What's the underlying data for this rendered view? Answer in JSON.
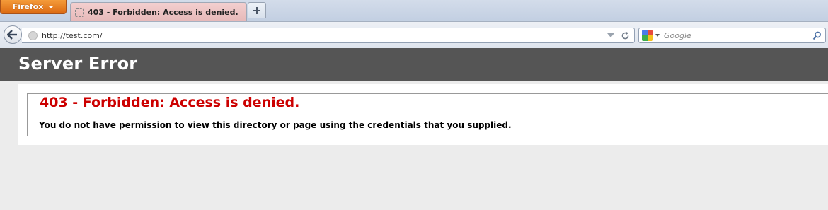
{
  "browser": {
    "menu_button_label": "Firefox",
    "tab": {
      "title": "403 - Forbidden: Access is denied."
    },
    "address_bar": {
      "url": "http://test.com/"
    },
    "search_bar": {
      "placeholder": "Google",
      "engine_icon": "google-icon"
    }
  },
  "page": {
    "header_title": "Server Error",
    "error": {
      "title": "403 - Forbidden: Access is denied.",
      "description": "You do not have permission to view this directory or page using the credentials that you supplied."
    }
  },
  "colors": {
    "firefox_button": "#e07a1e",
    "active_tab": "#ecc3c3",
    "header_bar": "#555555",
    "error_title": "#cc0000",
    "page_background": "#ececec"
  }
}
